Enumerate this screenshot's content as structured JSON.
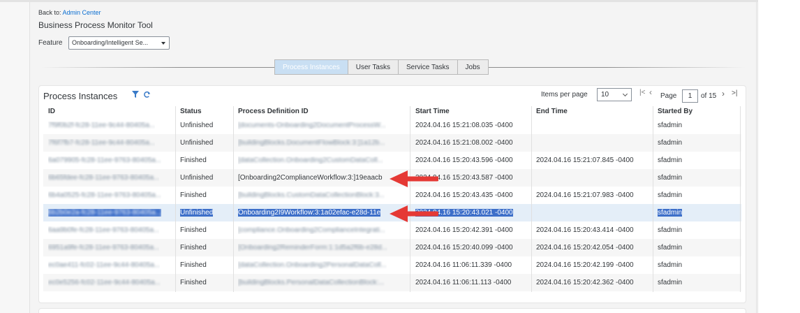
{
  "header": {
    "back_prefix": "Back to:",
    "back_link": "Admin Center",
    "title": "Business Process Monitor Tool",
    "feature_label": "Feature",
    "feature_value": "Onboarding/Intelligent Se..."
  },
  "tabs": [
    {
      "label": "Process Instances",
      "active": true
    },
    {
      "label": "User Tasks",
      "active": false
    },
    {
      "label": "Service Tasks",
      "active": false
    },
    {
      "label": "Jobs",
      "active": false
    }
  ],
  "panel": {
    "title": "Process Instances",
    "items_per_page_label": "Items per page",
    "items_per_page_value": "10",
    "page_label": "Page",
    "page_value": "1",
    "page_of": "of 15"
  },
  "columns": [
    "ID",
    "Status",
    "Process Definition ID",
    "Start Time",
    "End Time",
    "Started By"
  ],
  "rows": [
    {
      "id": "7f9f0b2f-fc28-11ee-9c44-80405a...",
      "status": "Unfinished",
      "def": "[documents-Onboarding2DocumentProcessW...",
      "start": "2024.04.16 15:21:08.035 -0400",
      "end": "",
      "by": "sfadmin",
      "blur_id": true,
      "blur_def": true
    },
    {
      "id": "7f6f7fb7-fc28-11ee-9c44-80405a...",
      "status": "Unfinished",
      "def": "[buildingBlocks.DocumentFlowBlock:3:]1a12b...",
      "start": "2024.04.16 15:21:08.002 -0400",
      "end": "",
      "by": "sfadmin",
      "blur_id": true,
      "blur_def": true
    },
    {
      "id": "6a079905-fc28-11ee-9763-80405a...",
      "status": "Finished",
      "def": "[dataCollection.Onboarding2CustomDataColl...",
      "start": "2024.04.16 15:20:43.596 -0400",
      "end": "2024.04.16 15:21:07.845 -0400",
      "by": "sfadmin",
      "blur_id": true,
      "blur_def": true
    },
    {
      "id": "6b65fdee-fc28-11ee-9763-80405a...",
      "status": "Unfinished",
      "def": "[Onboarding2ComplianceWorkflow:3:]19eaacb",
      "start": "2024.04.16 15:20:43.587 -0400",
      "end": "",
      "by": "sfadmin",
      "blur_id": true,
      "blur_def": false
    },
    {
      "id": "6b4a0525-fc28-11ee-9763-80405a...",
      "status": "Finished",
      "def": "[buildingBlocks.CustomDataCollectionBlock:3...",
      "start": "2024.04.16 15:20:43.435 -0400",
      "end": "2024.04.16 15:21:07.983 -0400",
      "by": "sfadmin",
      "blur_id": true,
      "blur_def": true
    },
    {
      "id": "6b2b0e2a-fc28-11ee-9763-80405a...",
      "status": "Unfinished",
      "def": "Onboarding2I9Workflow:3:1a02efac-e28d-11e",
      "start": "2024.04.16 15:20:43.021 -0400",
      "end": "",
      "by": "sfadmin",
      "blur_id": true,
      "blur_def": false,
      "selected": true
    },
    {
      "id": "6aa9b0fe-fc28-11ee-9763-80405a...",
      "status": "Finished",
      "def": "[compliance.Onboarding2ComplianceIntegrati...",
      "start": "2024.04.16 15:20:42.391 -0400",
      "end": "2024.04.16 15:20:43.414 -0400",
      "by": "sfadmin",
      "blur_id": true,
      "blur_def": true
    },
    {
      "id": "6951a9fe-fc28-11ee-9763-80405a...",
      "status": "Finished",
      "def": "[Onboarding2ReminderForm:1:1d5a2f6b-e28d...",
      "start": "2024.04.16 15:20:40.099 -0400",
      "end": "2024.04.16 15:20:42.054 -0400",
      "by": "sfadmin",
      "blur_id": true,
      "blur_def": true
    },
    {
      "id": "ec0ae411-fc02-11ee-9c44-80405a...",
      "status": "Finished",
      "def": "[dataCollection.Onboarding2PersonalDataColl...",
      "start": "2024.04.16 11:06:11.339 -0400",
      "end": "2024.04.16 15:20:42.199 -0400",
      "by": "sfadmin",
      "blur_id": true,
      "blur_def": true
    },
    {
      "id": "ec0e5256-fc02-11ee-9c44-80405a...",
      "status": "Finished",
      "def": "[buildingBlocks.PersonalDataCollectionBlock:...",
      "start": "2024.04.16 11:06:11.113 -0400",
      "end": "2024.04.16 15:20:42.362 -0400",
      "by": "sfadmin",
      "blur_id": true,
      "blur_def": true
    }
  ],
  "colors": {
    "link": "#0a6ed1",
    "arrow": "#e53935",
    "selection": "#3d6fc9",
    "active_tab": "#c9dff3"
  }
}
